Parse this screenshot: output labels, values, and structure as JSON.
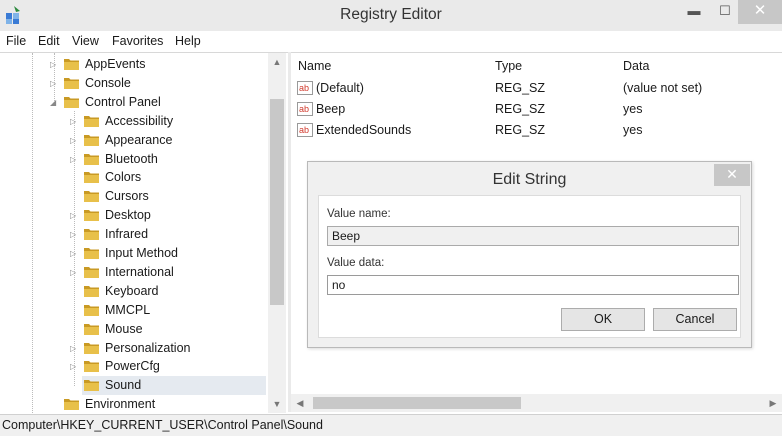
{
  "window": {
    "title": "Registry Editor",
    "minimize": "▬",
    "maximize": "☐",
    "close": "✕"
  },
  "menu": [
    {
      "label": "File"
    },
    {
      "label": "Edit"
    },
    {
      "label": "View"
    },
    {
      "label": "Favorites"
    },
    {
      "label": "Help"
    }
  ],
  "tree": {
    "items": [
      {
        "label": "AppEvents",
        "expander": "▷"
      },
      {
        "label": "Console",
        "expander": "▷"
      },
      {
        "label": "Control Panel",
        "expander": "◢"
      },
      {
        "label": "Accessibility",
        "expander": "▷"
      },
      {
        "label": "Appearance",
        "expander": "▷"
      },
      {
        "label": "Bluetooth",
        "expander": "▷"
      },
      {
        "label": "Colors",
        "expander": ""
      },
      {
        "label": "Cursors",
        "expander": ""
      },
      {
        "label": "Desktop",
        "expander": "▷"
      },
      {
        "label": "Infrared",
        "expander": "▷"
      },
      {
        "label": "Input Method",
        "expander": "▷"
      },
      {
        "label": "International",
        "expander": "▷"
      },
      {
        "label": "Keyboard",
        "expander": ""
      },
      {
        "label": "MMCPL",
        "expander": ""
      },
      {
        "label": "Mouse",
        "expander": ""
      },
      {
        "label": "Personalization",
        "expander": "▷"
      },
      {
        "label": "PowerCfg",
        "expander": "▷"
      },
      {
        "label": "Sound",
        "expander": ""
      },
      {
        "label": "Environment",
        "expander": ""
      }
    ]
  },
  "list": {
    "columns": {
      "name": "Name",
      "type": "Type",
      "data": "Data"
    },
    "rows": [
      {
        "name": "(Default)",
        "type": "REG_SZ",
        "data": "(value not set)"
      },
      {
        "name": "Beep",
        "type": "REG_SZ",
        "data": "yes"
      },
      {
        "name": "ExtendedSounds",
        "type": "REG_SZ",
        "data": "yes"
      }
    ],
    "value_icon_text": "ab"
  },
  "scroll": {
    "up": "▲",
    "down": "▼",
    "left": "◀",
    "right": "▶"
  },
  "dialog": {
    "title": "Edit String",
    "close": "✕",
    "value_name_label": "Value name:",
    "value_name": "Beep",
    "value_data_label": "Value data:",
    "value_data": "no",
    "ok_label": "OK",
    "cancel_label": "Cancel"
  },
  "status": {
    "path": "Computer\\HKEY_CURRENT_USER\\Control Panel\\Sound"
  },
  "colors": {
    "folder": "#e8c04a",
    "folder_dark": "#c99a24",
    "value_icon": "#d23b2e",
    "selection": "#e5eaf0"
  }
}
